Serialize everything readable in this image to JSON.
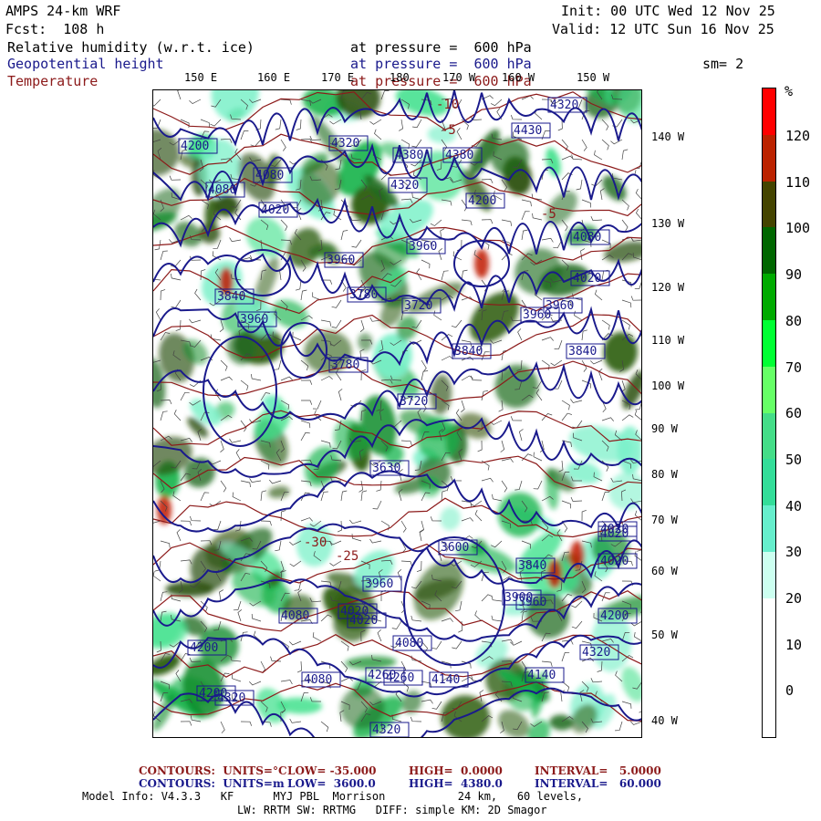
{
  "header": {
    "model": "AMPS 24-km WRF",
    "fcst": "Fcst:  108 h",
    "init": "Init: 00 UTC Wed 12 Nov 25",
    "valid": "Valid: 12 UTC Sun 16 Nov 25",
    "var1": "Relative humidity (w.r.t. ice)",
    "var2": "Geopotential height",
    "var3": "Temperature",
    "p1": "at pressure =  600 hPa",
    "p2": "at pressure =  600 hPa",
    "p3": "at pressure =  600 hPa",
    "sm": "sm= 2"
  },
  "lon_labels": [
    "150 E",
    "160 E",
    "170 E",
    "180",
    "170 W",
    "160 W",
    "150 W"
  ],
  "lat_labels": [
    "140 W",
    "130 W",
    "120 W",
    "110 W",
    "100 W",
    "90 W",
    "80 W",
    "70 W",
    "60 W",
    "50 W",
    "40 W"
  ],
  "colorbar": {
    "unit": "%",
    "labels": [
      "120",
      "110",
      "100",
      "90",
      "80",
      "70",
      "60",
      "50",
      "40",
      "30",
      "20",
      "10",
      "0"
    ],
    "colors": [
      "#ff0000",
      "#bb2200",
      "#444400",
      "#006600",
      "#00aa00",
      "#00ff33",
      "#66ff66",
      "#44dd88",
      "#33dd99",
      "#66eecc",
      "#ccfff0",
      "#ffffff",
      "#ffffff",
      "#ffffff"
    ]
  },
  "height_labels": [
    "4200",
    "4320",
    "4380",
    "4380",
    "4320",
    "4200",
    "4080",
    "4080",
    "4020",
    "3960",
    "3960",
    "3960",
    "3840",
    "3780",
    "3780",
    "3720",
    "3720",
    "3840",
    "3960",
    "3960",
    "3840",
    "4020",
    "4080",
    "3960",
    "4020",
    "4080",
    "4200",
    "4200",
    "4320",
    "4320",
    "4320",
    "4260",
    "4140",
    "4080",
    "4020",
    "3900",
    "3960",
    "3840",
    "4020",
    "4140",
    "4200",
    "4320",
    "4080",
    "4020",
    "4430",
    "3630",
    "3600",
    "4260",
    "4020"
  ],
  "temp_labels": [
    "-5",
    "-25",
    "-30",
    "-5",
    "-10"
  ],
  "footer": {
    "line1_label": "CONTOURS:  UNITS=°C",
    "line1_low": "LOW= -35.000",
    "line1_high": "HIGH=  0.0000",
    "line1_int": "INTERVAL=   5.0000",
    "line2_label": "CONTOURS:  UNITS=m",
    "line2_low": "LOW=  3600.0",
    "line2_high": "HIGH=  4380.0",
    "line2_int": "INTERVAL=   60.000",
    "model_info": "Model Info: V4.3.3   KF      MYJ PBL  Morrison           24 km,   60 levels,",
    "model_info2": "LW: RRTM SW: RRTMG   DIFF: simple KM: 2D Smagor"
  }
}
